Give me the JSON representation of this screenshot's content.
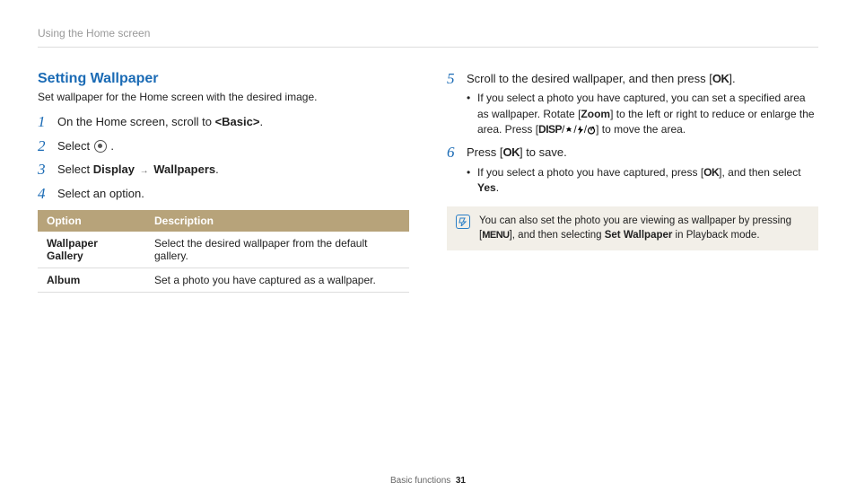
{
  "header": {
    "breadcrumb": "Using the Home screen"
  },
  "left": {
    "title": "Setting Wallpaper",
    "desc": "Set wallpaper for the Home screen with the desired image.",
    "step1": {
      "pre": "On the Home screen, scroll to ",
      "target": "<Basic>",
      "post": "."
    },
    "step2": {
      "pre": "Select ",
      "post": " ."
    },
    "step3": {
      "pre": "Select ",
      "a": "Display",
      "b": "Wallpapers",
      "post": "."
    },
    "step4": {
      "text": "Select an option."
    },
    "table": {
      "headers": {
        "opt": "Option",
        "desc": "Description"
      },
      "rows": [
        {
          "opt": "Wallpaper Gallery",
          "desc": "Select the desired wallpaper from the default gallery."
        },
        {
          "opt": "Album",
          "desc": "Set a photo you have captured as a wallpaper."
        }
      ]
    }
  },
  "right": {
    "step5": {
      "pre": "Scroll to the desired wallpaper, and then press [",
      "ok": "OK",
      "post": "].",
      "sub_a_pre": "If you select a photo you have captured, you can set a specified area as wallpaper. Rotate [",
      "sub_a_zoom": "Zoom",
      "sub_a_mid": "] to the left or right to reduce or enlarge the area. Press [",
      "sub_a_disp": "DISP",
      "sub_a_post": "] to move the area."
    },
    "step6": {
      "pre": "Press [",
      "ok": "OK",
      "post": "] to save.",
      "sub_pre": "If you select a photo you have captured, press [",
      "sub_ok": "OK",
      "sub_mid": "], and then select ",
      "sub_yes": "Yes",
      "sub_post": "."
    },
    "note": {
      "pre": "You can also set the photo you are viewing as wallpaper by pressing [",
      "menu": "MENU",
      "mid": "], and then selecting ",
      "bold": "Set Wallpaper",
      "post": " in Playback mode."
    }
  },
  "footer": {
    "section": "Basic functions",
    "page": "31"
  },
  "nums": {
    "n1": "1",
    "n2": "2",
    "n3": "3",
    "n4": "4",
    "n5": "5",
    "n6": "6"
  },
  "glyph": {
    "slash": "/",
    "arrow": "→",
    "bullet": "•"
  }
}
